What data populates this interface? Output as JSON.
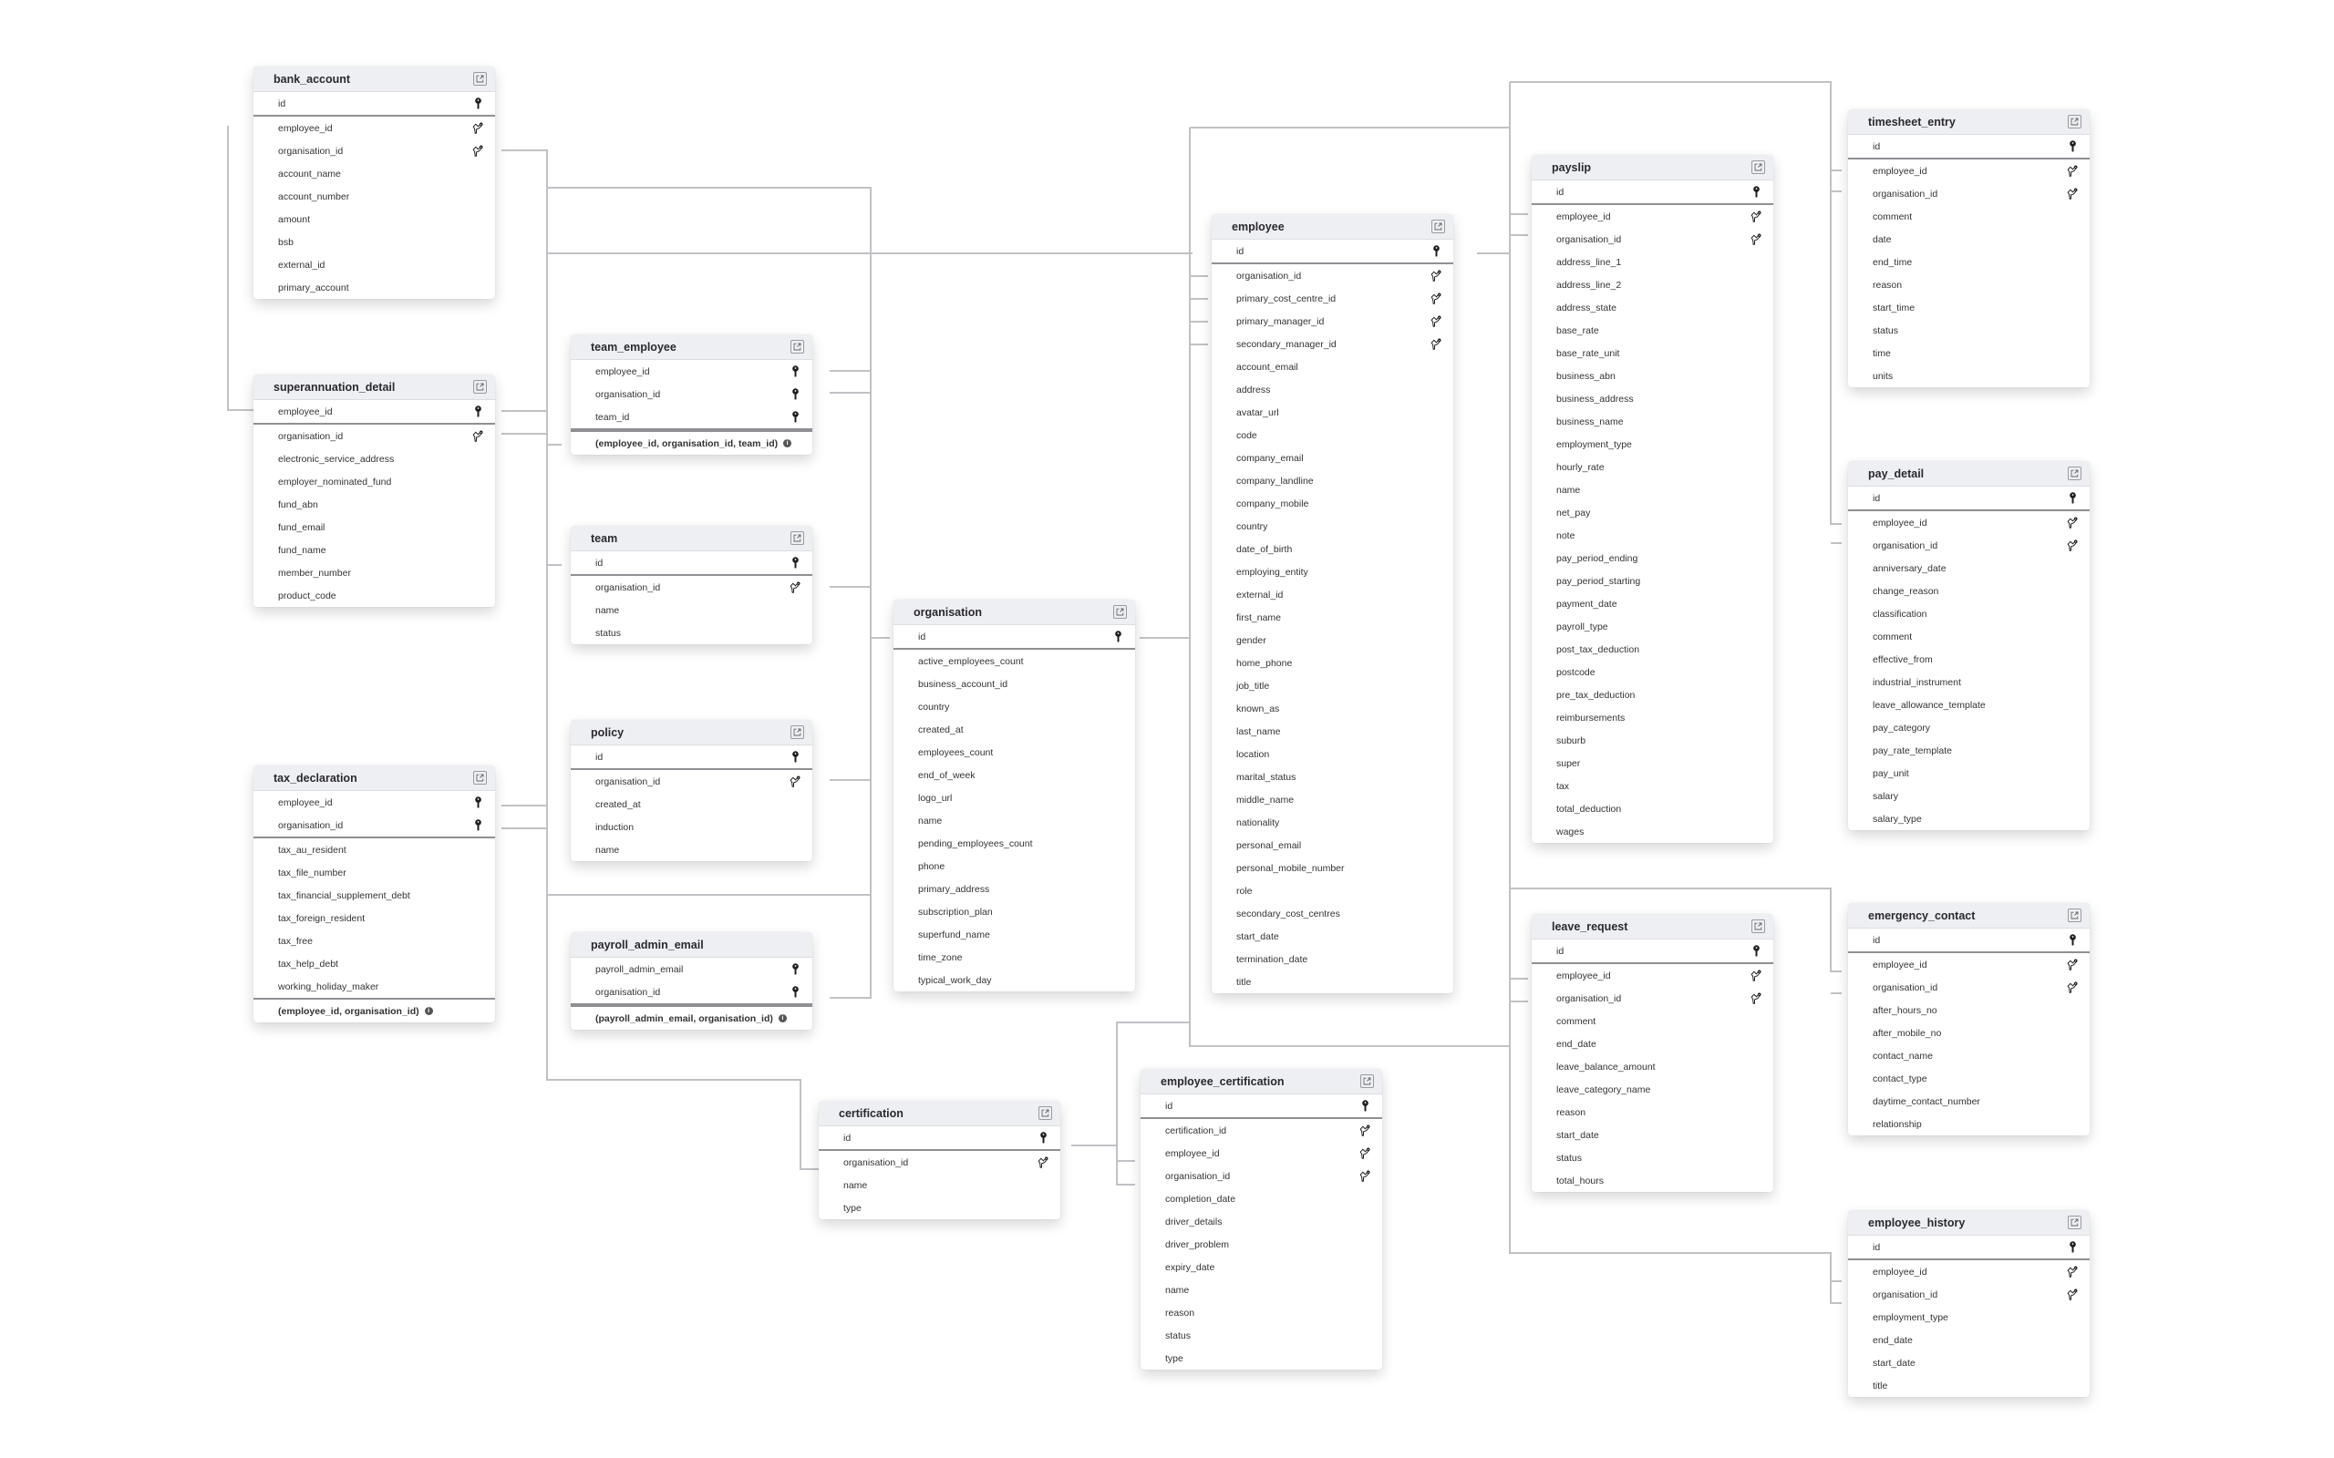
{
  "diagram": {
    "tables": [
      {
        "id": "bank_account",
        "name": "bank_account",
        "external_link": true,
        "columns": [
          {
            "name": "id",
            "key": "pk"
          },
          {
            "name": "employee_id",
            "key": "fk"
          },
          {
            "name": "organisation_id",
            "key": "fk"
          },
          {
            "name": "account_name"
          },
          {
            "name": "account_number"
          },
          {
            "name": "amount"
          },
          {
            "name": "bsb"
          },
          {
            "name": "external_id"
          },
          {
            "name": "primary_account"
          }
        ]
      },
      {
        "id": "superannuation_detail",
        "name": "superannuation_detail",
        "external_link": true,
        "columns": [
          {
            "name": "employee_id",
            "key": "pk"
          },
          {
            "name": "organisation_id",
            "key": "fk"
          },
          {
            "name": "electronic_service_address"
          },
          {
            "name": "employer_nominated_fund"
          },
          {
            "name": "fund_abn"
          },
          {
            "name": "fund_email"
          },
          {
            "name": "fund_name"
          },
          {
            "name": "member_number"
          },
          {
            "name": "product_code"
          }
        ]
      },
      {
        "id": "tax_declaration",
        "name": "tax_declaration",
        "external_link": true,
        "columns": [
          {
            "name": "employee_id",
            "key": "pk"
          },
          {
            "name": "organisation_id",
            "key": "pk"
          },
          {
            "name": "tax_au_resident"
          },
          {
            "name": "tax_file_number"
          },
          {
            "name": "tax_financial_supplement_debt"
          },
          {
            "name": "tax_foreign_resident"
          },
          {
            "name": "tax_free"
          },
          {
            "name": "tax_help_debt"
          },
          {
            "name": "working_holiday_maker"
          }
        ],
        "composite_key": "(employee_id, organisation_id)"
      },
      {
        "id": "team_employee",
        "name": "team_employee",
        "external_link": true,
        "columns": [
          {
            "name": "employee_id",
            "key": "pk"
          },
          {
            "name": "organisation_id",
            "key": "pk"
          },
          {
            "name": "team_id",
            "key": "pk"
          }
        ],
        "composite_key": "(employee_id, organisation_id, team_id)"
      },
      {
        "id": "team",
        "name": "team",
        "external_link": true,
        "columns": [
          {
            "name": "id",
            "key": "pk"
          },
          {
            "name": "organisation_id",
            "key": "fk"
          },
          {
            "name": "name"
          },
          {
            "name": "status"
          }
        ]
      },
      {
        "id": "policy",
        "name": "policy",
        "external_link": true,
        "columns": [
          {
            "name": "id",
            "key": "pk"
          },
          {
            "name": "organisation_id",
            "key": "fk"
          },
          {
            "name": "created_at"
          },
          {
            "name": "induction"
          },
          {
            "name": "name"
          }
        ]
      },
      {
        "id": "payroll_admin_email",
        "name": "payroll_admin_email",
        "external_link": false,
        "columns": [
          {
            "name": "payroll_admin_email",
            "key": "pk"
          },
          {
            "name": "organisation_id",
            "key": "pk"
          }
        ],
        "composite_key": "(payroll_admin_email, organisation_id)"
      },
      {
        "id": "organisation",
        "name": "organisation",
        "external_link": true,
        "columns": [
          {
            "name": "id",
            "key": "pk"
          },
          {
            "name": "active_employees_count"
          },
          {
            "name": "business_account_id"
          },
          {
            "name": "country"
          },
          {
            "name": "created_at"
          },
          {
            "name": "employees_count"
          },
          {
            "name": "end_of_week"
          },
          {
            "name": "logo_url"
          },
          {
            "name": "name"
          },
          {
            "name": "pending_employees_count"
          },
          {
            "name": "phone"
          },
          {
            "name": "primary_address"
          },
          {
            "name": "subscription_plan"
          },
          {
            "name": "superfund_name"
          },
          {
            "name": "time_zone"
          },
          {
            "name": "typical_work_day"
          }
        ]
      },
      {
        "id": "certification",
        "name": "certification",
        "external_link": true,
        "columns": [
          {
            "name": "id",
            "key": "pk"
          },
          {
            "name": "organisation_id",
            "key": "fk"
          },
          {
            "name": "name"
          },
          {
            "name": "type"
          }
        ]
      },
      {
        "id": "employee",
        "name": "employee",
        "external_link": true,
        "columns": [
          {
            "name": "id",
            "key": "pk"
          },
          {
            "name": "organisation_id",
            "key": "fk"
          },
          {
            "name": "primary_cost_centre_id",
            "key": "fk"
          },
          {
            "name": "primary_manager_id",
            "key": "fk"
          },
          {
            "name": "secondary_manager_id",
            "key": "fk"
          },
          {
            "name": "account_email"
          },
          {
            "name": "address"
          },
          {
            "name": "avatar_url"
          },
          {
            "name": "code"
          },
          {
            "name": "company_email"
          },
          {
            "name": "company_landline"
          },
          {
            "name": "company_mobile"
          },
          {
            "name": "country"
          },
          {
            "name": "date_of_birth"
          },
          {
            "name": "employing_entity"
          },
          {
            "name": "external_id"
          },
          {
            "name": "first_name"
          },
          {
            "name": "gender"
          },
          {
            "name": "home_phone"
          },
          {
            "name": "job_title"
          },
          {
            "name": "known_as"
          },
          {
            "name": "last_name"
          },
          {
            "name": "location"
          },
          {
            "name": "marital_status"
          },
          {
            "name": "middle_name"
          },
          {
            "name": "nationality"
          },
          {
            "name": "personal_email"
          },
          {
            "name": "personal_mobile_number"
          },
          {
            "name": "role"
          },
          {
            "name": "secondary_cost_centres"
          },
          {
            "name": "start_date"
          },
          {
            "name": "termination_date"
          },
          {
            "name": "title"
          }
        ]
      },
      {
        "id": "employee_certification",
        "name": "employee_certification",
        "external_link": true,
        "columns": [
          {
            "name": "id",
            "key": "pk"
          },
          {
            "name": "certification_id",
            "key": "fk"
          },
          {
            "name": "employee_id",
            "key": "fk"
          },
          {
            "name": "organisation_id",
            "key": "fk"
          },
          {
            "name": "completion_date"
          },
          {
            "name": "driver_details"
          },
          {
            "name": "driver_problem"
          },
          {
            "name": "expiry_date"
          },
          {
            "name": "name"
          },
          {
            "name": "reason"
          },
          {
            "name": "status"
          },
          {
            "name": "type"
          }
        ]
      },
      {
        "id": "payslip",
        "name": "payslip",
        "external_link": true,
        "columns": [
          {
            "name": "id",
            "key": "pk"
          },
          {
            "name": "employee_id",
            "key": "fk"
          },
          {
            "name": "organisation_id",
            "key": "fk"
          },
          {
            "name": "address_line_1"
          },
          {
            "name": "address_line_2"
          },
          {
            "name": "address_state"
          },
          {
            "name": "base_rate"
          },
          {
            "name": "base_rate_unit"
          },
          {
            "name": "business_abn"
          },
          {
            "name": "business_address"
          },
          {
            "name": "business_name"
          },
          {
            "name": "employment_type"
          },
          {
            "name": "hourly_rate"
          },
          {
            "name": "name"
          },
          {
            "name": "net_pay"
          },
          {
            "name": "note"
          },
          {
            "name": "pay_period_ending"
          },
          {
            "name": "pay_period_starting"
          },
          {
            "name": "payment_date"
          },
          {
            "name": "payroll_type"
          },
          {
            "name": "post_tax_deduction"
          },
          {
            "name": "postcode"
          },
          {
            "name": "pre_tax_deduction"
          },
          {
            "name": "reimbursements"
          },
          {
            "name": "suburb"
          },
          {
            "name": "super"
          },
          {
            "name": "tax"
          },
          {
            "name": "total_deduction"
          },
          {
            "name": "wages"
          }
        ]
      },
      {
        "id": "leave_request",
        "name": "leave_request",
        "external_link": true,
        "columns": [
          {
            "name": "id",
            "key": "pk"
          },
          {
            "name": "employee_id",
            "key": "fk"
          },
          {
            "name": "organisation_id",
            "key": "fk"
          },
          {
            "name": "comment"
          },
          {
            "name": "end_date"
          },
          {
            "name": "leave_balance_amount"
          },
          {
            "name": "leave_category_name"
          },
          {
            "name": "reason"
          },
          {
            "name": "start_date"
          },
          {
            "name": "status"
          },
          {
            "name": "total_hours"
          }
        ]
      },
      {
        "id": "timesheet_entry",
        "name": "timesheet_entry",
        "external_link": true,
        "columns": [
          {
            "name": "id",
            "key": "pk"
          },
          {
            "name": "employee_id",
            "key": "fk"
          },
          {
            "name": "organisation_id",
            "key": "fk"
          },
          {
            "name": "comment"
          },
          {
            "name": "date"
          },
          {
            "name": "end_time"
          },
          {
            "name": "reason"
          },
          {
            "name": "start_time"
          },
          {
            "name": "status"
          },
          {
            "name": "time"
          },
          {
            "name": "units"
          }
        ]
      },
      {
        "id": "pay_detail",
        "name": "pay_detail",
        "external_link": true,
        "columns": [
          {
            "name": "id",
            "key": "pk"
          },
          {
            "name": "employee_id",
            "key": "fk"
          },
          {
            "name": "organisation_id",
            "key": "fk"
          },
          {
            "name": "anniversary_date"
          },
          {
            "name": "change_reason"
          },
          {
            "name": "classification"
          },
          {
            "name": "comment"
          },
          {
            "name": "effective_from"
          },
          {
            "name": "industrial_instrument"
          },
          {
            "name": "leave_allowance_template"
          },
          {
            "name": "pay_category"
          },
          {
            "name": "pay_rate_template"
          },
          {
            "name": "pay_unit"
          },
          {
            "name": "salary"
          },
          {
            "name": "salary_type"
          }
        ]
      },
      {
        "id": "emergency_contact",
        "name": "emergency_contact",
        "external_link": true,
        "columns": [
          {
            "name": "id",
            "key": "pk"
          },
          {
            "name": "employee_id",
            "key": "fk"
          },
          {
            "name": "organisation_id",
            "key": "fk"
          },
          {
            "name": "after_hours_no"
          },
          {
            "name": "after_mobile_no"
          },
          {
            "name": "contact_name"
          },
          {
            "name": "contact_type"
          },
          {
            "name": "daytime_contact_number"
          },
          {
            "name": "relationship"
          }
        ]
      },
      {
        "id": "employee_history",
        "name": "employee_history",
        "external_link": true,
        "columns": [
          {
            "name": "id",
            "key": "pk"
          },
          {
            "name": "employee_id",
            "key": "fk"
          },
          {
            "name": "organisation_id",
            "key": "fk"
          },
          {
            "name": "employment_type"
          },
          {
            "name": "end_date"
          },
          {
            "name": "start_date"
          },
          {
            "name": "title"
          }
        ]
      }
    ],
    "icons": {
      "primary_key": "key-icon",
      "foreign_key": "foreign-key-icon",
      "external_link": "external-link-icon",
      "info": "info-icon"
    },
    "colors": {
      "header_bg": "#eeeff2",
      "edge": "#c1c1c6",
      "key_icon": "#1f1f22"
    }
  }
}
